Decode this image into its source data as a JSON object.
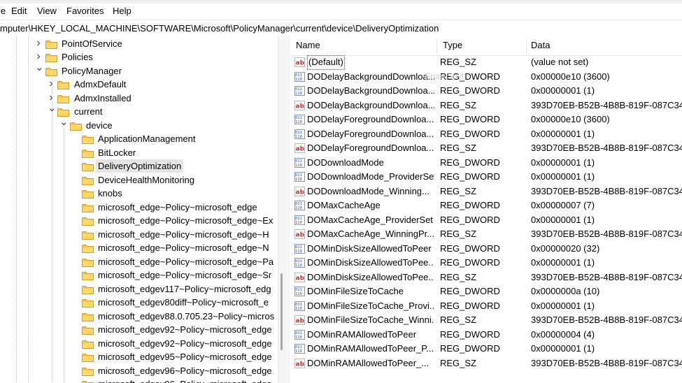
{
  "menu": [
    "le",
    "Edit",
    "View",
    "Favorites",
    "Help"
  ],
  "address": "mputer\\HKEY_LOCAL_MACHINE\\SOFTWARE\\Microsoft\\PolicyManager\\current\\device\\DeliveryOptimization",
  "tree": [
    {
      "label": "PointOfService",
      "level": 0,
      "chevron": "right"
    },
    {
      "label": "Policies",
      "level": 0,
      "chevron": "right"
    },
    {
      "label": "PolicyManager",
      "level": 0,
      "chevron": "down"
    },
    {
      "label": "AdmxDefault",
      "level": 1,
      "chevron": "right"
    },
    {
      "label": "AdmxInstalled",
      "level": 1,
      "chevron": "right"
    },
    {
      "label": "current",
      "level": 1,
      "chevron": "down"
    },
    {
      "label": "device",
      "level": 2,
      "chevron": "down"
    },
    {
      "label": "ApplicationManagement",
      "level": 3,
      "chevron": ""
    },
    {
      "label": "BitLocker",
      "level": 3,
      "chevron": ""
    },
    {
      "label": "DeliveryOptimization",
      "level": 3,
      "chevron": "",
      "selected": true
    },
    {
      "label": "DeviceHealthMonitoring",
      "level": 3,
      "chevron": ""
    },
    {
      "label": "knobs",
      "level": 3,
      "chevron": ""
    },
    {
      "label": "microsoft_edge~Policy~microsoft_edge",
      "level": 3,
      "chevron": ""
    },
    {
      "label": "microsoft_edge~Policy~microsoft_edge~Ex",
      "level": 3,
      "chevron": ""
    },
    {
      "label": "microsoft_edge~Policy~microsoft_edge~H",
      "level": 3,
      "chevron": ""
    },
    {
      "label": "microsoft_edge~Policy~microsoft_edge~N",
      "level": 3,
      "chevron": ""
    },
    {
      "label": "microsoft_edge~Policy~microsoft_edge~Pa",
      "level": 3,
      "chevron": ""
    },
    {
      "label": "microsoft_edge~Policy~microsoft_edge~Sr",
      "level": 3,
      "chevron": ""
    },
    {
      "label": "microsoft_edgev117~Policy~microsoft_edg",
      "level": 3,
      "chevron": ""
    },
    {
      "label": "microsoft_edgev80diff~Policy~microsoft_e",
      "level": 3,
      "chevron": ""
    },
    {
      "label": "microsoft_edgev88.0.705.23~Policy~micros",
      "level": 3,
      "chevron": ""
    },
    {
      "label": "microsoft_edgev92~Policy~microsoft_edge",
      "level": 3,
      "chevron": ""
    },
    {
      "label": "microsoft_edgev92~Policy~microsoft_edge",
      "level": 3,
      "chevron": ""
    },
    {
      "label": "microsoft_edgev95~Policy~microsoft_edge",
      "level": 3,
      "chevron": ""
    },
    {
      "label": "microsoft_edgev96~Policy~microsoft_edge",
      "level": 3,
      "chevron": ""
    },
    {
      "label": "microsoft_edgev96~Policy~microsoft_edge",
      "level": 3,
      "chevron": ""
    }
  ],
  "columns": {
    "name": "Name",
    "type": "Type",
    "data": "Data"
  },
  "values": [
    {
      "name": "(Default)",
      "type": "REG_SZ",
      "data": "(value not set)",
      "kind": "sz"
    },
    {
      "name": "DODelayBackgroundDownloa...",
      "type": "REG_DWORD",
      "data": "0x00000e10 (3600)",
      "kind": "dword"
    },
    {
      "name": "DODelayBackgroundDownloa...",
      "type": "REG_DWORD",
      "data": "0x00000001 (1)",
      "kind": "dword"
    },
    {
      "name": "DODelayBackgroundDownloa...",
      "type": "REG_SZ",
      "data": "393D70EB-B52B-4B8B-819F-087C342BC",
      "kind": "sz"
    },
    {
      "name": "DODelayForegroundDownloa...",
      "type": "REG_DWORD",
      "data": "0x00000e10 (3600)",
      "kind": "dword"
    },
    {
      "name": "DODelayForegroundDownloa...",
      "type": "REG_DWORD",
      "data": "0x00000001 (1)",
      "kind": "dword"
    },
    {
      "name": "DODelayForegroundDownloa...",
      "type": "REG_SZ",
      "data": "393D70EB-B52B-4B8B-819F-087C342BC",
      "kind": "sz"
    },
    {
      "name": "DODownloadMode",
      "type": "REG_DWORD",
      "data": "0x00000001 (1)",
      "kind": "dword"
    },
    {
      "name": "DODownloadMode_ProviderSet",
      "type": "REG_DWORD",
      "data": "0x00000001 (1)",
      "kind": "dword"
    },
    {
      "name": "DODownloadMode_Winning...",
      "type": "REG_SZ",
      "data": "393D70EB-B52B-4B8B-819F-087C342BC",
      "kind": "sz"
    },
    {
      "name": "DOMaxCacheAge",
      "type": "REG_DWORD",
      "data": "0x00000007 (7)",
      "kind": "dword"
    },
    {
      "name": "DOMaxCacheAge_ProviderSet",
      "type": "REG_DWORD",
      "data": "0x00000001 (1)",
      "kind": "dword"
    },
    {
      "name": "DOMaxCacheAge_WinningPr...",
      "type": "REG_SZ",
      "data": "393D70EB-B52B-4B8B-819F-087C342BC",
      "kind": "sz"
    },
    {
      "name": "DOMinDiskSizeAllowedToPeer",
      "type": "REG_DWORD",
      "data": "0x00000020 (32)",
      "kind": "dword"
    },
    {
      "name": "DOMinDiskSizeAllowedToPee...",
      "type": "REG_DWORD",
      "data": "0x00000001 (1)",
      "kind": "dword"
    },
    {
      "name": "DOMinDiskSizeAllowedToPee...",
      "type": "REG_SZ",
      "data": "393D70EB-B52B-4B8B-819F-087C342BC",
      "kind": "sz"
    },
    {
      "name": "DOMinFileSizeToCache",
      "type": "REG_DWORD",
      "data": "0x0000000a (10)",
      "kind": "dword"
    },
    {
      "name": "DOMinFileSizeToCache_Provi...",
      "type": "REG_DWORD",
      "data": "0x00000001 (1)",
      "kind": "dword"
    },
    {
      "name": "DOMinFileSizeToCache_Winni...",
      "type": "REG_SZ",
      "data": "393D70EB-B52B-4B8B-819F-087C342BC",
      "kind": "sz"
    },
    {
      "name": "DOMinRAMAllowedToPeer",
      "type": "REG_DWORD",
      "data": "0x00000004 (4)",
      "kind": "dword"
    },
    {
      "name": "DOMinRAMAllowedToPeer_P...",
      "type": "REG_DWORD",
      "data": "0x00000001 (1)",
      "kind": "dword"
    },
    {
      "name": "DOMinRAMAllowedToPeer_...",
      "type": "REG_SZ",
      "data": "393D70EB-B52B-4B8B-819F-087C342BC",
      "kind": "sz"
    }
  ],
  "watermark": "From Spyl"
}
